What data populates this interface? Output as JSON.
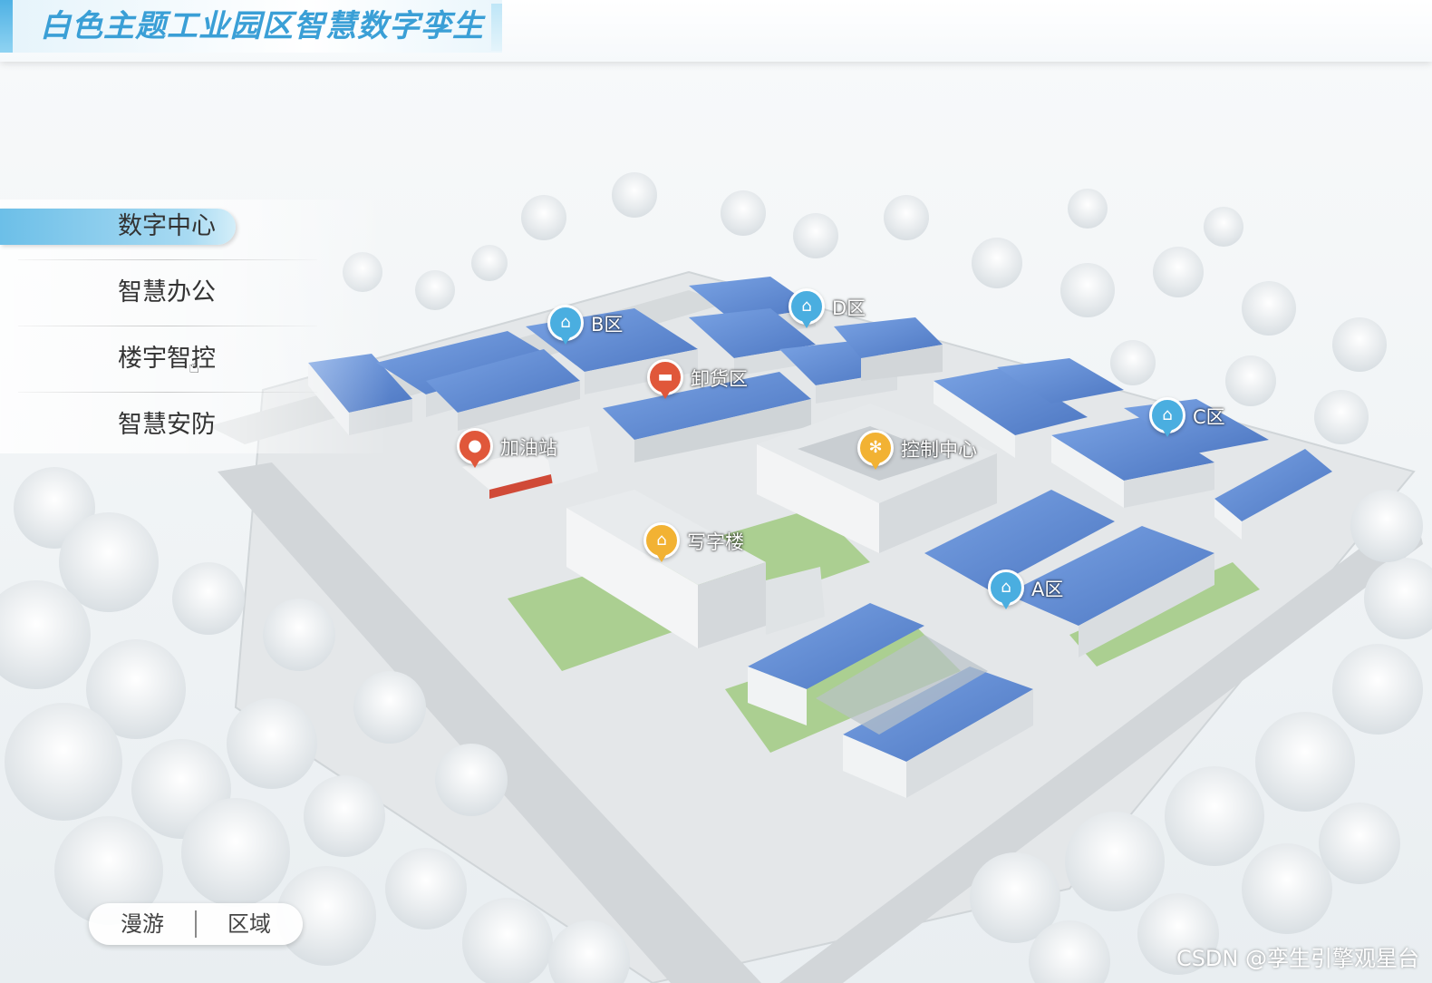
{
  "header": {
    "title": "白色主题工业园区智慧数字孪生"
  },
  "menu": {
    "items": [
      {
        "label": "数字中心",
        "active": true
      },
      {
        "label": "智慧办公",
        "active": false
      },
      {
        "label": "楼宇智控",
        "active": false
      },
      {
        "label": "智慧安防",
        "active": false
      }
    ]
  },
  "mode_toggle": {
    "roam_label": "漫游",
    "area_label": "区域"
  },
  "markers": [
    {
      "label": "B区",
      "icon": "warehouse-icon",
      "color": "#4aaee0"
    },
    {
      "label": "D区",
      "icon": "warehouse-icon",
      "color": "#4aaee0"
    },
    {
      "label": "卸货区",
      "icon": "truck-icon",
      "color": "#e0573a"
    },
    {
      "label": "C区",
      "icon": "warehouse-icon",
      "color": "#4aaee0"
    },
    {
      "label": "加油站",
      "icon": "fuel-tanker-icon",
      "color": "#e0573a"
    },
    {
      "label": "控制中心",
      "icon": "atom-icon",
      "color": "#f2b233"
    },
    {
      "label": "写字楼",
      "icon": "home-icon",
      "color": "#f2b233"
    },
    {
      "label": "A区",
      "icon": "warehouse-icon",
      "color": "#4aaee0"
    }
  ],
  "watermark": "CSDN @孪生引擎观星台",
  "colors": {
    "accent": "#3a9fd6",
    "roof_blue": "#5b86d1",
    "lawn": "#8ec26a"
  }
}
